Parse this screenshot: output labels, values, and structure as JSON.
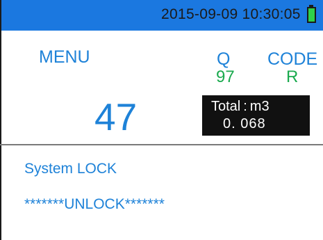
{
  "status_bar": {
    "datetime": "2015-09-09 10:30:05",
    "battery_icon": "battery-full-icon",
    "bar_color": "#1b78e0",
    "battery_color": "#2fd14a"
  },
  "display": {
    "menu_label": "MENU",
    "q_label": "Q",
    "q_value": "97",
    "code_label": "CODE",
    "code_value": "R",
    "main_value": "47",
    "total": {
      "label": "Total : m3",
      "value": "0. 068"
    }
  },
  "status": {
    "system_lock": "System LOCK",
    "unlock": "*******UNLOCK*******"
  },
  "colors": {
    "label_blue": "#1e82d8",
    "value_green": "#1aaa4e"
  }
}
